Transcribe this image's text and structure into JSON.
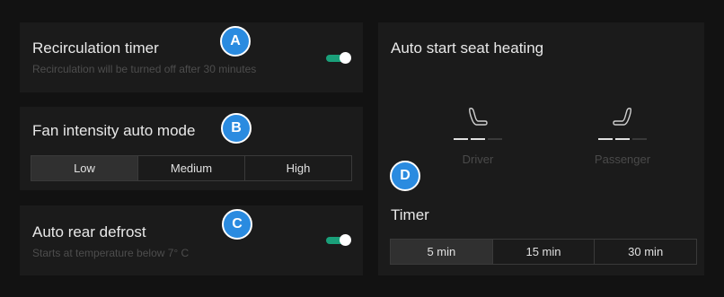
{
  "recirculation": {
    "title": "Recirculation timer",
    "subtitle": "Recirculation will be turned off after 30 minutes",
    "badge": "A",
    "toggle_on": true
  },
  "fan": {
    "title": "Fan intensity auto mode",
    "badge": "B",
    "options": [
      "Low",
      "Medium",
      "High"
    ],
    "selected": "Low"
  },
  "defrost": {
    "title": "Auto rear defrost",
    "subtitle": "Starts at temperature below 7° C",
    "badge": "C",
    "toggle_on": true
  },
  "seat_heating": {
    "title": "Auto start seat heating",
    "badge": "D",
    "driver": {
      "label": "Driver",
      "level": 2,
      "max_level": 3
    },
    "passenger": {
      "label": "Passenger",
      "level": 2,
      "max_level": 3
    },
    "timer_title": "Timer",
    "timer_options": [
      "5 min",
      "15 min",
      "30 min"
    ],
    "timer_selected": "5 min"
  },
  "colors": {
    "accent_toggle": "#1aa07a",
    "badge": "#2a8be0",
    "panel": "#1b1b1b",
    "background": "#121212"
  }
}
